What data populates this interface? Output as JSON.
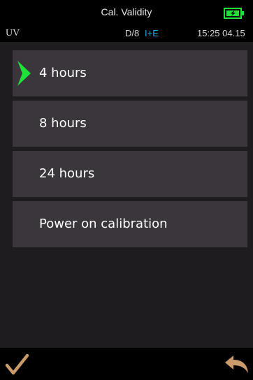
{
  "header": {
    "title": "Cal. Validity"
  },
  "status": {
    "light": "UV",
    "geometry": "D/8",
    "mode": "I+E",
    "time": "15:25 04.15"
  },
  "options": [
    {
      "label": "4 hours",
      "selected": true
    },
    {
      "label": "8 hours",
      "selected": false
    },
    {
      "label": "24 hours",
      "selected": false
    },
    {
      "label": "Power on calibration",
      "selected": false
    }
  ],
  "colors": {
    "accent_green": "#22e03a",
    "mode_blue": "#1fa8e0",
    "button_tan": "#c99a6a"
  },
  "icons": {
    "battery": "battery-charging-icon",
    "confirm": "checkmark-icon",
    "back": "back-arrow-icon",
    "selection": "selection-arrow-icon"
  }
}
